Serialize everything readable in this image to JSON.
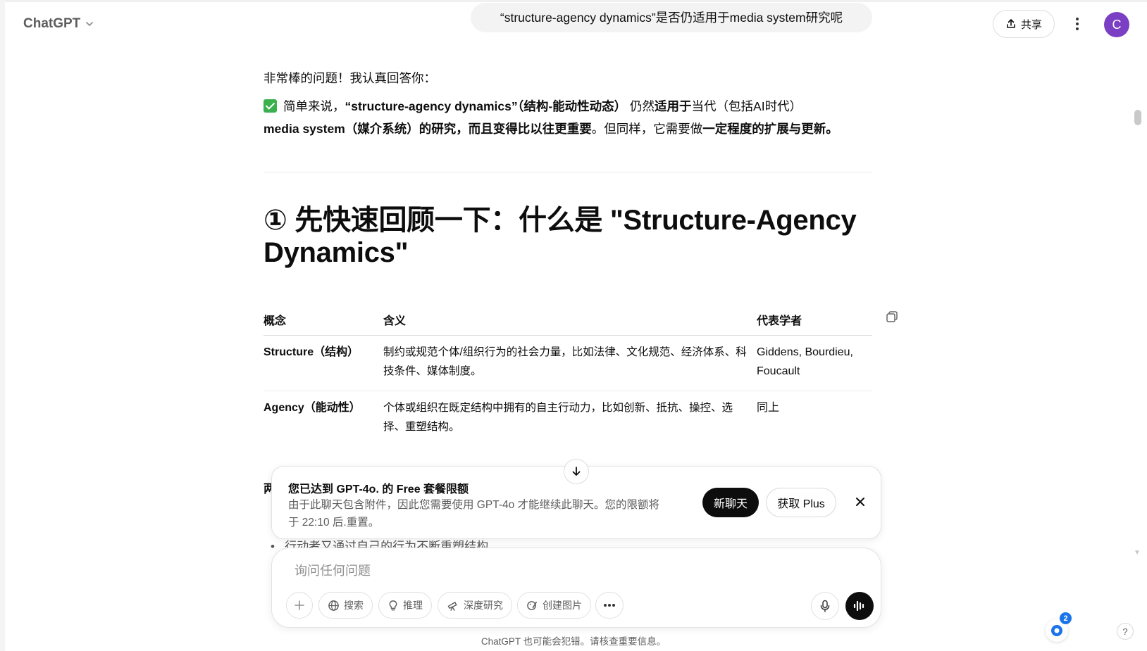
{
  "header": {
    "model_name": "ChatGPT",
    "share_label": "共享",
    "avatar_letter": "C"
  },
  "user_message": "“structure-agency dynamics”是否仍适用于media system研究呢",
  "assistant": {
    "intro": "非常棒的问题！我认真回答你：",
    "summary": {
      "part1": "简单来说，",
      "part2": "“structure-agency dynamics”（结构-能动性动态）",
      "part3": " 仍然",
      "part4": "适用于",
      "part5": "当代（包括AI时代）",
      "part6": "media system（媒介系统）的研究，而且变得比以往更重要",
      "part7": "。但同样，它需要做",
      "part8": "一定程度的扩展与更新。"
    },
    "heading": "① 先快速回顾一下：什么是 \"Structure-Agency Dynamics\"",
    "table": {
      "headers": [
        "概念",
        "含义",
        "代表学者"
      ],
      "rows": [
        [
          "Structure（结构）",
          "制约或规范个体/组织行为的社会力量，比如法律、文化规范、经济体系、科技条件、媒体制度。",
          "Giddens, Bourdieu, Foucault"
        ],
        [
          "Agency（能动性）",
          "个体或组织在既定结构中拥有的自主行动力，比如创新、抵抗、操控、选择、重塑结构。",
          "同上"
        ]
      ]
    },
    "partial_heading": "两",
    "partial_bullet": "行动者又通过自己的行为不断重塑结构"
  },
  "limit_banner": {
    "title": "您已达到 GPT-4o. 的 Free 套餐限额",
    "body": "由于此聊天包含附件，因此您需要使用 GPT-4o 才能继续此聊天。您的限额将于 22:10 后.重置。",
    "new_chat_label": "新聊天",
    "get_plus_label": "获取 Plus"
  },
  "composer": {
    "placeholder": "询问任何问题",
    "tools": {
      "search": "搜索",
      "reason": "推理",
      "deep_research": "深度研究",
      "create_image": "创建图片"
    }
  },
  "disclaimer": "ChatGPT 也可能会犯错。请核查重要信息。",
  "notification_count": "2",
  "help_label": "?",
  "icons": [
    "chevron-down-icon",
    "share-icon",
    "more-vertical-icon",
    "copy-icon",
    "arrow-down-icon",
    "close-icon",
    "plus-icon",
    "globe-icon",
    "lightbulb-icon",
    "telescope-icon",
    "image-edit-icon",
    "more-horizontal-icon",
    "mic-icon",
    "voice-icon",
    "checkbox-icon"
  ],
  "colors": {
    "accent": "#7b3fc4",
    "check": "#3ab14e",
    "primary_button": "#0d0d0d",
    "bubble": "#f3f3f3"
  }
}
